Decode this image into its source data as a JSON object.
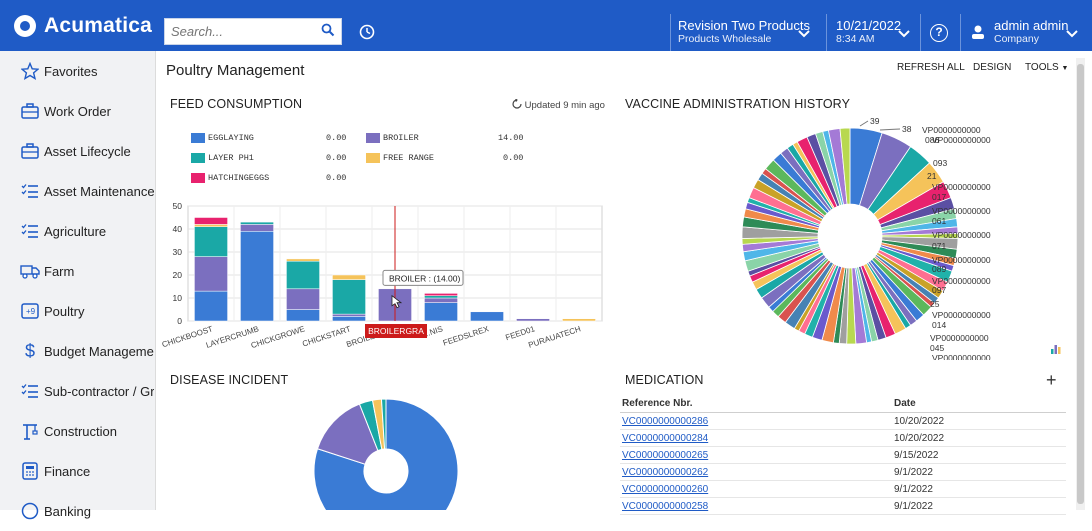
{
  "app": {
    "logo": "Acumatica",
    "search_placeholder": "Search...",
    "branch_title": "Revision Two Products",
    "branch_sub": "Products Wholesale",
    "date": "10/21/2022",
    "time": "8:34 AM",
    "help": "?",
    "user_name": "admin admin",
    "user_company": "Company"
  },
  "sidebar": {
    "items": [
      {
        "label": "Favorites",
        "icon": "star-icon"
      },
      {
        "label": "Work Order",
        "icon": "briefcase-icon"
      },
      {
        "label": "Asset Lifecycle",
        "icon": "briefcase-icon"
      },
      {
        "label": "Asset Maintenance",
        "icon": "list-check-icon"
      },
      {
        "label": "Agriculture",
        "icon": "list-check-icon"
      },
      {
        "label": "Farm",
        "icon": "truck-icon"
      },
      {
        "label": "Poultry",
        "icon": "box-arrow-icon"
      },
      {
        "label": "Budget Management",
        "icon": "dollar-icon"
      },
      {
        "label": "Sub-contractor / Gr...",
        "icon": "list-check-icon"
      },
      {
        "label": "Construction",
        "icon": "crane-icon"
      },
      {
        "label": "Finance",
        "icon": "calculator-icon"
      },
      {
        "label": "Banking",
        "icon": "bank-icon"
      }
    ]
  },
  "page": {
    "title": "Poultry Management",
    "refresh": "REFRESH ALL",
    "design": "DESIGN",
    "tools": "TOOLS"
  },
  "feed": {
    "title": "FEED CONSUMPTION",
    "updated": "Updated 9 min ago",
    "tooltip": "BROILER : (14.00)",
    "highlight_label": "BROILERGRA"
  },
  "vaccine": {
    "title": "VACCINE ADMINISTRATION HISTORY",
    "labels": [
      "39",
      "38",
      "VP0000000000",
      "086",
      "VP0000000000",
      "093",
      "21",
      "VP0000000000",
      "017",
      "VP0000000000",
      "061",
      "VP0000000000",
      "071",
      "VP0000000000",
      "089",
      "VP0000000000",
      "097",
      "25",
      "VP0000000000",
      "014",
      "VP0000000000",
      "045",
      "VP0000000000"
    ]
  },
  "disease": {
    "title": "DISEASE INCIDENT"
  },
  "medication": {
    "title": "MEDICATION",
    "add": "+",
    "col_ref": "Reference Nbr.",
    "col_date": "Date",
    "rows": [
      {
        "ref": "VC0000000000286",
        "date": "10/20/2022"
      },
      {
        "ref": "VC0000000000284",
        "date": "10/20/2022"
      },
      {
        "ref": "VC0000000000265",
        "date": "9/15/2022"
      },
      {
        "ref": "VC0000000000262",
        "date": "9/1/2022"
      },
      {
        "ref": "VC0000000000260",
        "date": "9/1/2022"
      },
      {
        "ref": "VC0000000000258",
        "date": "9/1/2022"
      }
    ]
  },
  "colors": {
    "brand": "#1f5bc6",
    "egglaying": "#3a7bd5",
    "broiler": "#7b6fbf",
    "layer": "#1aa8a6",
    "free_range": "#f5c35a",
    "hatching": "#e8226e",
    "highlight": "#cc1a1a"
  },
  "chart_data": [
    {
      "type": "bar",
      "stacked": true,
      "title": "FEED CONSUMPTION",
      "categories": [
        "CHICKBOOST",
        "LAYERCRUMB",
        "CHICKGROWE",
        "CHICKSTART",
        "BROILERGRA",
        "...NIS",
        "FEEDSLREX",
        "FEED01",
        "PURAUATECH"
      ],
      "series": [
        {
          "name": "EGGLAYING",
          "total": "0.00",
          "color": "#3a7bd5",
          "values": [
            13,
            39,
            5,
            2,
            0,
            8,
            4,
            0,
            0
          ]
        },
        {
          "name": "BROILER",
          "total": "14.00",
          "color": "#7b6fbf",
          "values": [
            15,
            3,
            9,
            1,
            14,
            2,
            0,
            1,
            0
          ]
        },
        {
          "name": "LAYER PH1",
          "total": "0.00",
          "color": "#1aa8a6",
          "values": [
            13,
            1,
            12,
            15,
            0,
            1,
            0,
            0,
            0
          ]
        },
        {
          "name": "FREE RANGE",
          "total": "0.00",
          "color": "#f5c35a",
          "values": [
            1,
            0,
            1,
            2,
            0,
            0,
            0,
            0,
            1
          ]
        },
        {
          "name": "HATCHINGEGGS",
          "total": "0.00",
          "color": "#e8226e",
          "values": [
            3,
            0,
            0,
            0,
            0,
            1,
            0,
            0,
            0
          ]
        }
      ],
      "ylim": [
        0,
        50
      ],
      "yticks": [
        0,
        10,
        20,
        30,
        40,
        50
      ],
      "grid": true,
      "legend": "top-left"
    },
    {
      "type": "pie",
      "title": "VACCINE ADMINISTRATION HISTORY",
      "donut": true,
      "slice_count": 70,
      "first_slices": [
        {
          "label": "39",
          "value": 39
        },
        {
          "label": "38",
          "value": 38
        },
        {
          "label": "VP0000000000086",
          "value": 30
        },
        {
          "label": "VP0000000000093",
          "value": 28
        },
        {
          "label": "21",
          "value": 21
        }
      ]
    },
    {
      "type": "pie",
      "title": "DISEASE INCIDENT",
      "donut": true,
      "slices": [
        {
          "value": 80,
          "color": "#3a7bd5"
        },
        {
          "value": 14,
          "color": "#7b6fbf"
        },
        {
          "value": 3,
          "color": "#1aa8a6"
        },
        {
          "value": 2,
          "color": "#f5c35a"
        },
        {
          "value": 1,
          "color": "#1aa8a6"
        }
      ]
    }
  ]
}
